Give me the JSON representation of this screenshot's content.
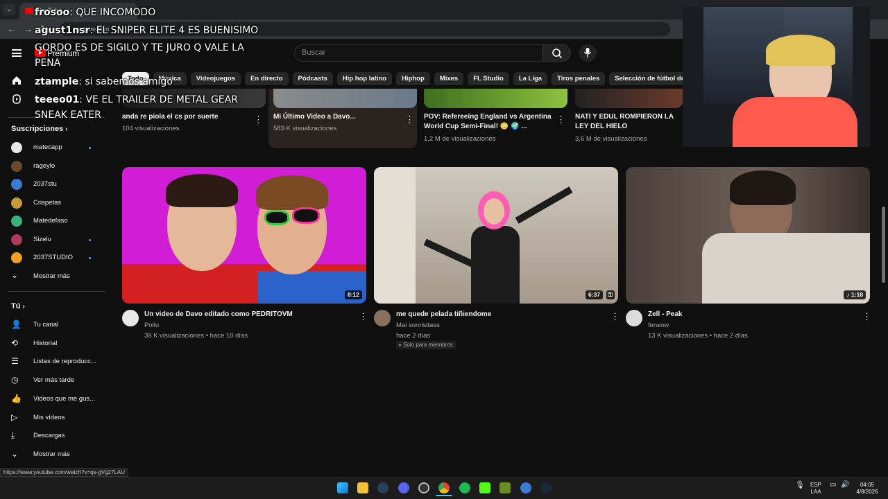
{
  "browser": {
    "tab_title": "YouTube",
    "url": "youtube.com",
    "status_url": "https://www.youtube.com/watch?v=qs-gVg27LAU"
  },
  "header": {
    "logo_text": "Premium",
    "search_placeholder": "Buscar"
  },
  "chips": [
    "Todo",
    "Música",
    "Videojuegos",
    "En directo",
    "Pódcasts",
    "Hip hop latino",
    "Hiphop",
    "Mixes",
    "FL Studio",
    "La Liga",
    "Tiros penales",
    "Selección de fútbol de Argentina"
  ],
  "sidebar": {
    "subs_heading": "Suscripciones",
    "subscriptions": [
      {
        "name": "matecapp",
        "live": true
      },
      {
        "name": "rageylo",
        "live": false
      },
      {
        "name": "2037stu",
        "live": false
      },
      {
        "name": "Crispetas",
        "live": false
      },
      {
        "name": "Matedefaso",
        "live": false
      },
      {
        "name": "Sizelu",
        "live": true
      },
      {
        "name": "2037STUDIO",
        "live": true
      }
    ],
    "show_more": "Mostrar más",
    "you_heading": "Tú",
    "you_items": [
      "Tu canal",
      "Historial",
      "Listas de reproducc...",
      "Ver más tarde",
      "Videos que me gus...",
      "Mis vídeos",
      "Descargas",
      "Mostrar más"
    ]
  },
  "top_videos": [
    {
      "title": "anda re piola el cs por suerte",
      "meta": "104 visualizaciones"
    },
    {
      "title": "Mi Último Video a Davo...",
      "meta": "583 K visualizaciones"
    },
    {
      "title": "POV: Refereeing England vs Argentina World Cup Semi-Final! 😳 🌍 ...",
      "meta": "1,2 M de visualizaciones"
    },
    {
      "title": "NATI Y EDUL ROMPIERON LA LEY DEL HIELO",
      "meta": "3,6 M de visualizaciones"
    }
  ],
  "videos": [
    {
      "title": "Un video de Davo editado como PEDRITOVM",
      "channel": "Pollo",
      "meta": "39 K visualizaciones • hace 10 días",
      "duration": "8:12",
      "badge": ""
    },
    {
      "title": "me quede pelada tiñiendome",
      "channel": "Mai sonrisitass",
      "meta": "hace 2 días",
      "duration": "6:37",
      "badge": "Solo para miembros"
    },
    {
      "title": "Zell - Peak",
      "channel": "ferwow",
      "meta": "13 K visualizaciones • hace 2 días",
      "duration": "♪ 1:18",
      "badge": ""
    }
  ],
  "chat": [
    {
      "user": "frosoo",
      "msg": "QUE INCOMODO"
    },
    {
      "user": "agust1nsr",
      "msg": "EL SNIPER ELITE 4 ES BUENISIMO"
    },
    {
      "user": "",
      "msg": "GORDO ES DE SIGILO Y TE JURO Q VALE LA"
    },
    {
      "user": "",
      "msg": "PENA"
    },
    {
      "user": "ztample",
      "msg": "si sabemos amigo"
    },
    {
      "user": "teeeo01",
      "msg": "VE EL TRAILER DE METAL GEAR"
    },
    {
      "user": "",
      "msg": "SNEAK EATER"
    }
  ],
  "tray": {
    "lang_top": "ESP",
    "lang_bottom": "LAA",
    "time": "04:05",
    "date": "4/8/2026"
  },
  "colors": {
    "bg": "#0f0f0f",
    "accent": "#ff0000",
    "live": "#3ea6ff",
    "member_badge": "#2ba640"
  }
}
